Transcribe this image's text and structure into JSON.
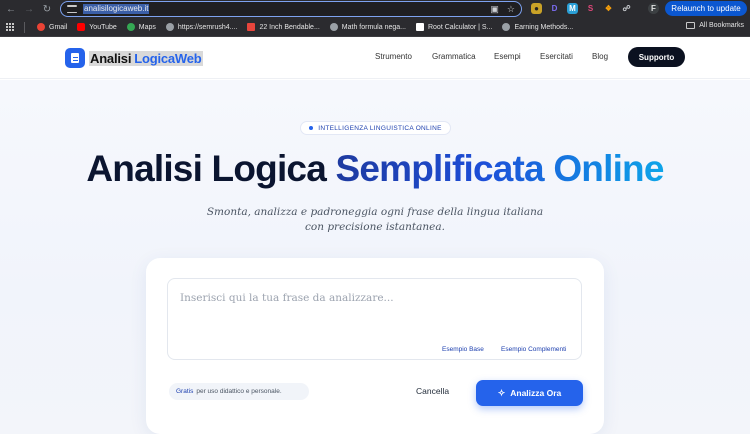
{
  "browser": {
    "url": "analisilogicaweb.it",
    "relaunch_label": "Relaunch to update",
    "bookmarks": [
      {
        "label": "Gmail",
        "color": "#ea4335"
      },
      {
        "label": "YouTube",
        "color": "#ff0000"
      },
      {
        "label": "Maps",
        "color": "#34a853"
      },
      {
        "label": "https://semrush4....",
        "color": "#9aa0a6"
      },
      {
        "label": "22 Inch Bendable...",
        "color": "#e8453c"
      },
      {
        "label": "Math formula nega...",
        "color": "#9aa0a6"
      },
      {
        "label": "Root Calculator | S...",
        "color": "#ffffff"
      },
      {
        "label": "Earning Methods...",
        "color": "#9aa0a6"
      }
    ],
    "all_bookmarks_label": "All Bookmarks",
    "extensions": [
      {
        "label": "D",
        "color": "#7c6cf2"
      },
      {
        "label": "M",
        "color": "#2a9fd6"
      },
      {
        "label": "S",
        "color": "#e0487a"
      },
      {
        "label": "F",
        "color": "#5f6368"
      }
    ]
  },
  "header": {
    "logo_part1": "Analisi",
    "logo_part2": "LogicaWeb",
    "nav": [
      "Strumento",
      "Grammatica",
      "Esempi",
      "Esercitati",
      "Blog"
    ],
    "support_label": "Supporto"
  },
  "hero": {
    "badge": "INTELLIGENZA LINGUISTICA ONLINE",
    "title_part1": "Analisi Logica",
    "title_part2": "Semplificata Online",
    "subtitle": "Smonta, analizza e padroneggia ogni frase della lingua italiana con precisione istantanea."
  },
  "analyzer": {
    "placeholder": "Inserisci qui la tua frase da analizzare...",
    "example_base": "Esempio Base",
    "example_complements": "Esempio Complementi",
    "free_highlight": "Gratis",
    "free_text": "per uso didattico e personale.",
    "cancel_label": "Cancella",
    "analyze_label": "Analizza Ora"
  },
  "colors": {
    "accent": "#2563eb",
    "dark": "#0b1530",
    "support_button": "#0b1120"
  }
}
